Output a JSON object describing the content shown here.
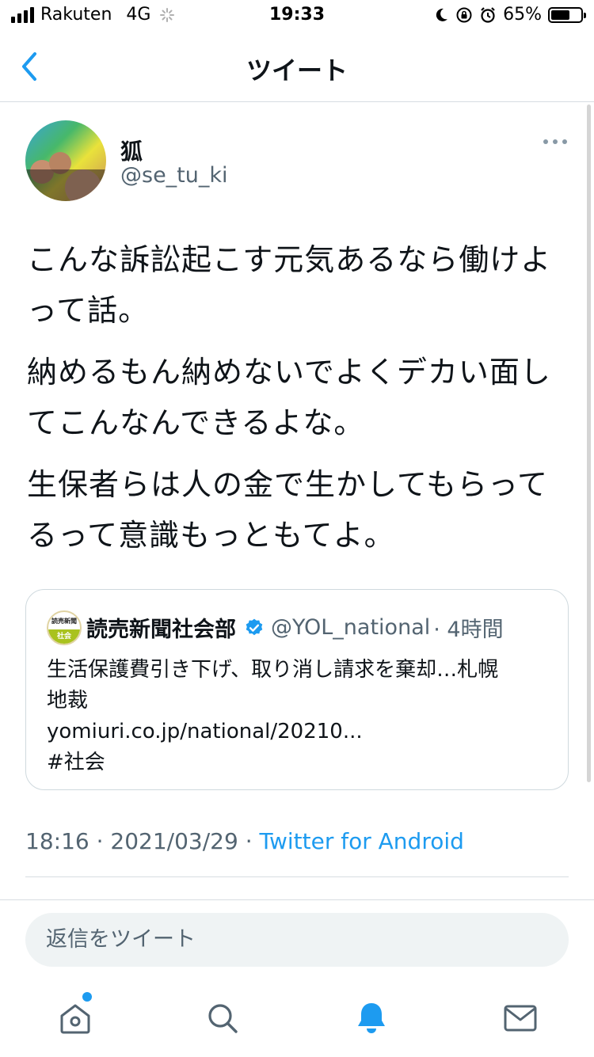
{
  "status_bar": {
    "carrier": "Rakuten",
    "network": "4G",
    "time": "19:33",
    "battery_text": "65%",
    "battery_level": 0.65
  },
  "nav": {
    "title": "ツイート",
    "back_icon": "chevron-left-icon"
  },
  "tweet": {
    "name": "狐",
    "handle": "@se_tu_ki",
    "paragraphs": [
      "こんな訴訟起こす元気あるなら働けよって話。",
      "納めるもん納めないでよくデカい面してこんなんできるよな。",
      "生保者らは人の金で生かしてもらってるって意識もっともてよ。"
    ],
    "quote": {
      "logo_text_top": "読売新聞",
      "logo_text_bottom": "社会",
      "name": "読売新聞社会部",
      "handle": "@YOL_national",
      "time": "· 4時間",
      "text_lines": [
        "生活保護費引き下げ、取り消し請求を棄却…札幌",
        "地裁",
        "yomiuri.co.jp/national/20210...",
        "#社会"
      ]
    },
    "meta": {
      "time": "18:16",
      "date": "2021/03/29",
      "separator": " · ",
      "source": "Twitter for Android"
    }
  },
  "reply": {
    "placeholder": "返信をツイート"
  },
  "tabbar": {
    "items": [
      "home-icon",
      "search-icon",
      "notifications-icon",
      "messages-icon"
    ],
    "accent": "#1d9bf0"
  },
  "colors": {
    "accent": "#1d9bf0",
    "secondary_text": "#536471",
    "border": "#cfd9de"
  }
}
